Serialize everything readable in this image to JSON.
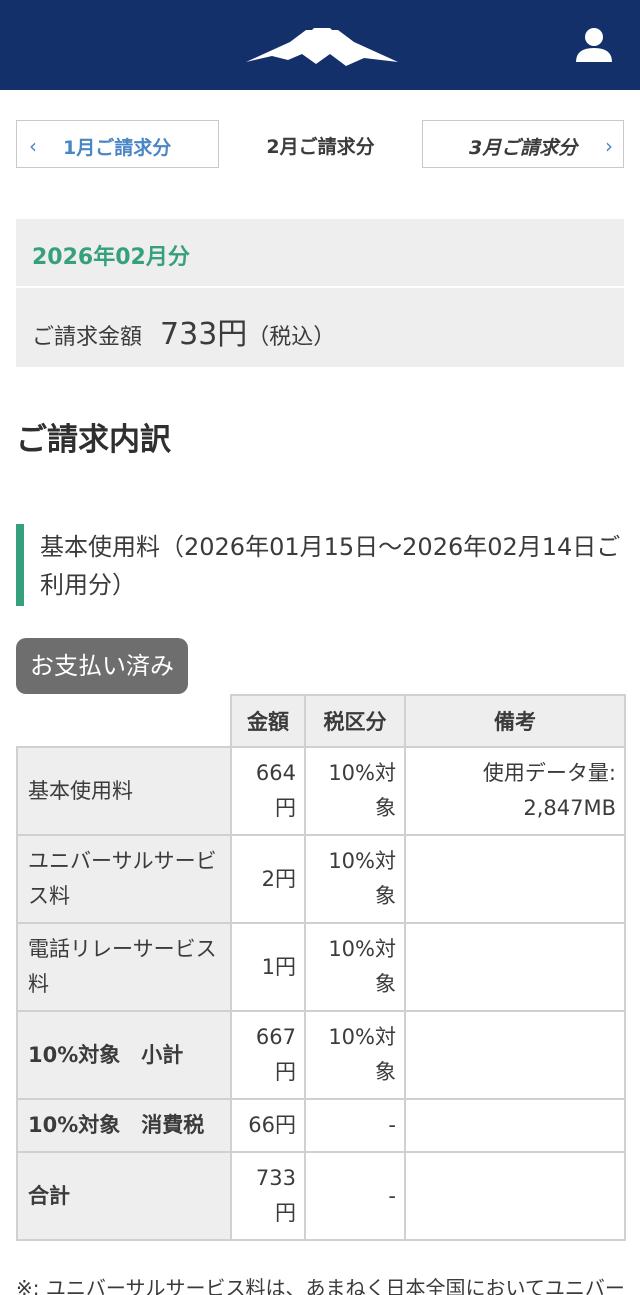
{
  "header": {
    "logo_icon": "mount-fuji-logo",
    "user_icon": "user-icon",
    "bg_color": "#13306b"
  },
  "month_nav": {
    "prev_label": "1月ご請求分",
    "current_label": "2月ご請求分",
    "next_label": "3月ご請求分",
    "prev_chevron": "‹",
    "next_chevron": "›"
  },
  "summary": {
    "period": "2026年02月分",
    "amount_label": "ご請求金額",
    "amount_value": "733円",
    "amount_tax": "（税込）",
    "accent_color": "#36a07e"
  },
  "breakdown": {
    "title": "ご請求内訳",
    "subsection": "基本使用料（2026年01月15日〜2026年02月14日ご利用分）",
    "paid_badge": "お支払い済み"
  },
  "table": {
    "headers": [
      "金額",
      "税区分",
      "備考"
    ],
    "rows": [
      {
        "label": "基本使用料",
        "amount": "664円",
        "tax": "10%対象",
        "note": "使用データ量: 2,847MB"
      },
      {
        "label": "ユニバーサルサービス料",
        "amount": "2円",
        "tax": "10%対象",
        "note": ""
      },
      {
        "label": "電話リレーサービス料",
        "amount": "1円",
        "tax": "10%対象",
        "note": ""
      },
      {
        "label": "10%対象　小計",
        "amount": "667円",
        "tax": "10%対象",
        "note": ""
      },
      {
        "label": "10%対象　消費税",
        "amount": "66円",
        "tax": "-",
        "note": ""
      },
      {
        "label": "合計",
        "amount": "733円",
        "tax": "-",
        "note": ""
      }
    ]
  },
  "footnote": "※: ユニバーサルサービス料は、あまねく日本全国においてユニバー"
}
